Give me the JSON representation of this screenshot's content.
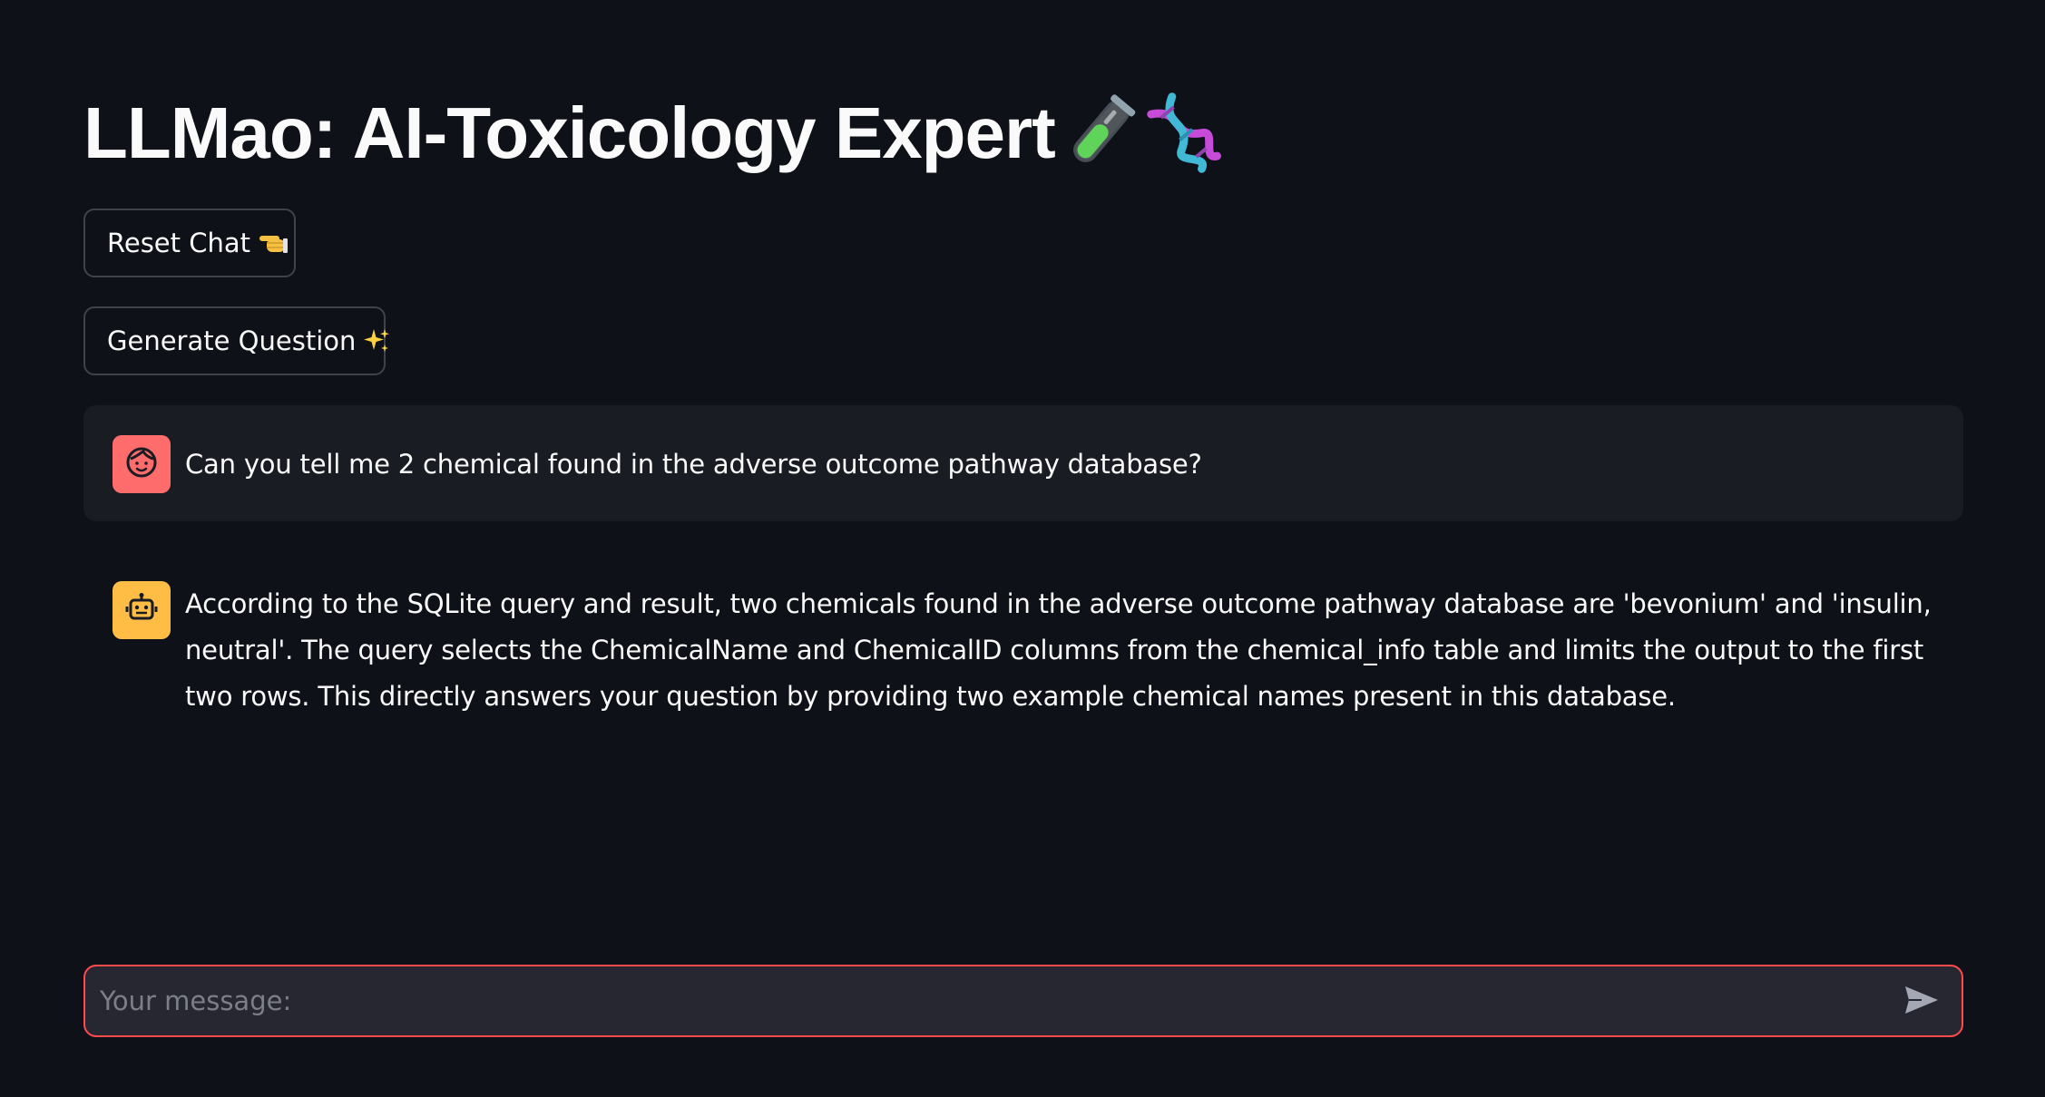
{
  "header": {
    "title": "LLMao: AI-Toxicology Expert",
    "title_icons": [
      "test-tube-icon",
      "dna-icon"
    ]
  },
  "buttons": {
    "reset_label": "Reset Chat",
    "reset_emoji": "pointing-hand-icon",
    "generate_label": "Generate Question",
    "generate_emoji": "sparkles-icon"
  },
  "messages": [
    {
      "role": "user",
      "avatar_icon": "user-face-icon",
      "text": "Can you tell me 2 chemical found in the adverse outcome pathway database?"
    },
    {
      "role": "assistant",
      "avatar_icon": "robot-icon",
      "text": "According to the SQLite query and result, two chemicals found in the adverse outcome pathway database are 'bevonium' and 'insulin, neutral'. The query selects the ChemicalName and ChemicalID columns from the chemical_info table and limits the output to the first two rows. This directly answers your question by providing two example chemical names present in this database."
    }
  ],
  "chat_input": {
    "placeholder": "Your message:",
    "value": "",
    "send_icon": "send-icon"
  },
  "colors": {
    "background": "#0e1117",
    "user_bubble": "#1a1c24",
    "user_avatar": "#ff6c6c",
    "bot_avatar": "#ffbd45",
    "input_border": "#ff4b4b",
    "input_bg": "#262730"
  }
}
